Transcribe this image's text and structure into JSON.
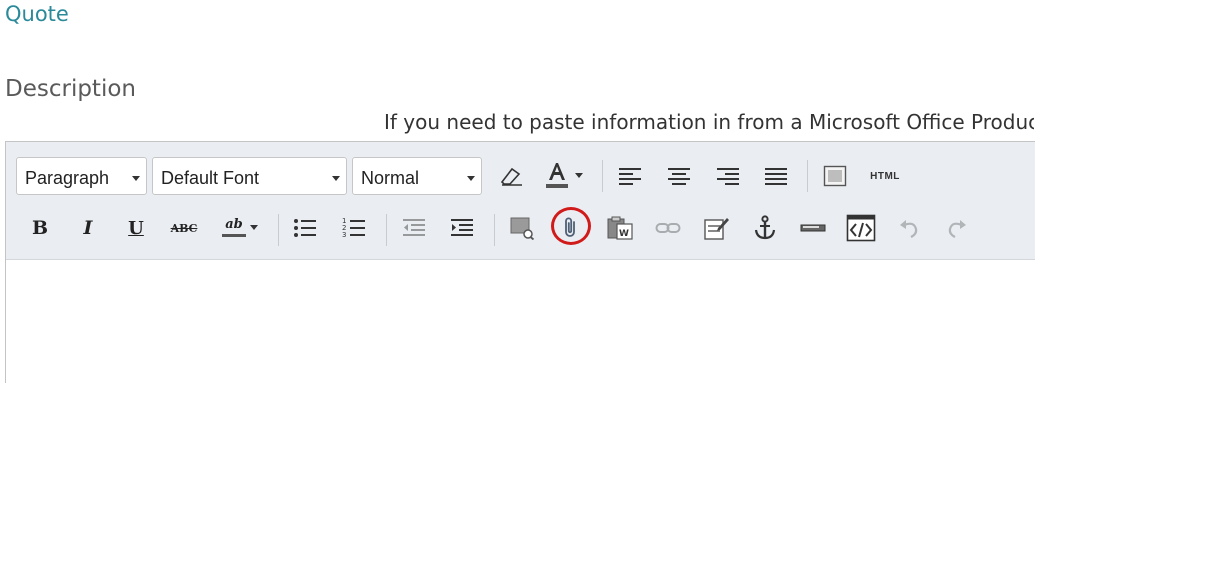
{
  "page": {
    "quote_link": "Quote",
    "description_label": "Description",
    "hint_text": "If you need to paste information in from a Microsoft Office Product please"
  },
  "toolbar": {
    "format_select": "Paragraph",
    "font_select": "Default Font",
    "size_select": "Normal",
    "html_button": "HTML",
    "bold": "B",
    "italic": "I",
    "underline": "U",
    "strikethrough": "ABC",
    "spellcheck": "ab"
  },
  "colors": {
    "link": "#2a8a9a",
    "toolbar_bg": "#eaeef2",
    "highlight_ring": "#d11a1a",
    "font_color_bar": "#555555"
  }
}
